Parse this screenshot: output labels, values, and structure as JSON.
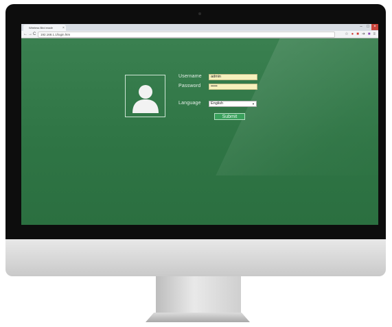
{
  "browser": {
    "tab_title": "Wireless Bird eradir",
    "tab_close": "×",
    "url": "192.168.1.1/login.htm",
    "window_controls": [
      "–",
      "□",
      "×"
    ],
    "nav": {
      "back": "←",
      "forward": "→",
      "reload": "C"
    }
  },
  "login": {
    "username_label": "Username",
    "username_value": "admin",
    "password_label": "Password",
    "password_value": "•••••",
    "language_label": "Language",
    "language_selected": "English",
    "submit_label": "Submit"
  },
  "colors": {
    "page_green": "#2f7545",
    "input_yellow": "#f6f1bd",
    "button_green": "#3aa05c"
  },
  "icons": [
    "user-avatar-icon",
    "chevron-down-icon",
    "star-icon",
    "extension-icon"
  ]
}
